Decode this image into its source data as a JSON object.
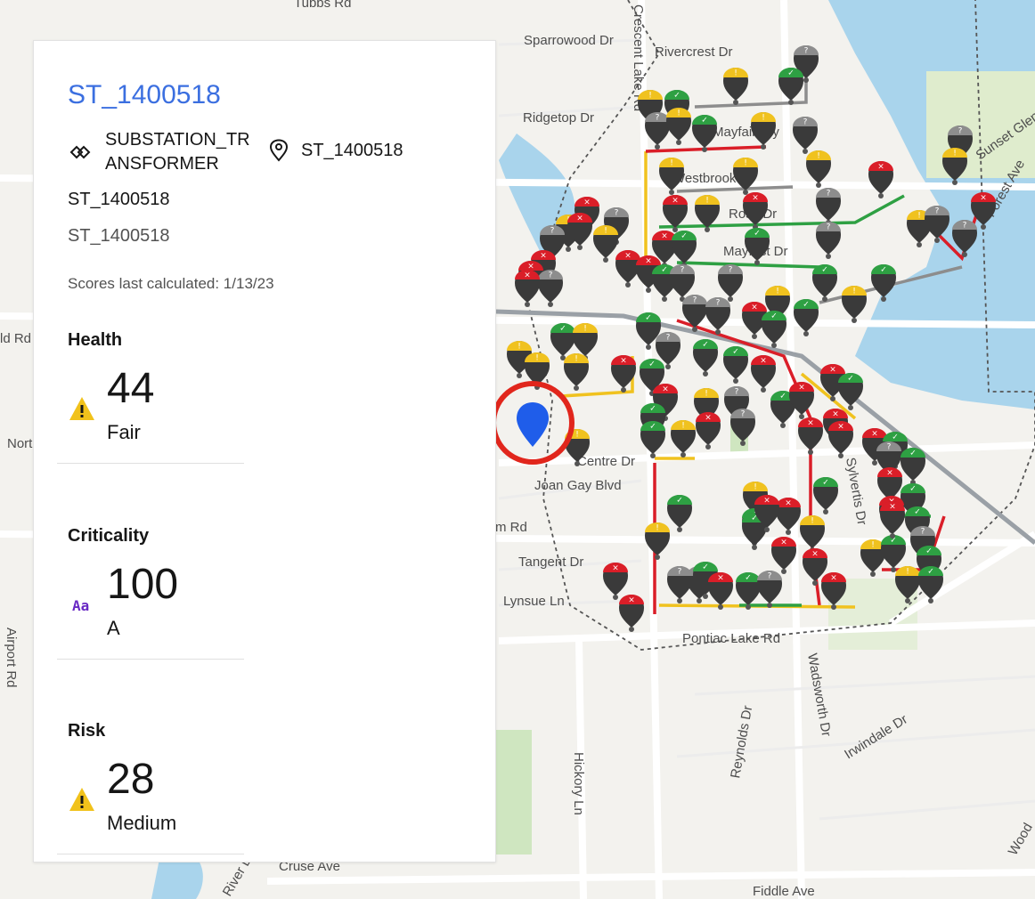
{
  "asset": {
    "title": "ST_1400518",
    "type": "SUBSTATION_TRANSFORMER",
    "location": "ST_1400518",
    "line1": "ST_1400518",
    "line2": "ST_1400518",
    "scores_calculated": "Scores last calculated: 1/13/23"
  },
  "scores": [
    {
      "label": "Health",
      "value": "44",
      "rating": "Fair",
      "icon": "warning-icon",
      "icon_color": "#f1c21b"
    },
    {
      "label": "Criticality",
      "value": "100",
      "rating": "A",
      "icon": "grade-icon",
      "icon_text": "Aa",
      "icon_color": "#6929c4"
    },
    {
      "label": "Risk",
      "value": "28",
      "rating": "Medium",
      "icon": "warning-icon",
      "icon_color": "#f1c21b"
    }
  ],
  "map": {
    "streets": [
      "Tubbs Rd",
      "Sparrowood Dr",
      "Rivercrest Dr",
      "Ridgetop Dr",
      "Crescent Lake Rd",
      "Mayfair Wy",
      "Westbrook Dr",
      "Ross Dr",
      "Mayfest Dr",
      "Centre Dr",
      "Joan Gay Blvd",
      "Tangent Dr",
      "Lynsue Ln",
      "Pontiac Lake Rd",
      "Wadsworth Dr",
      "Irwindale Dr",
      "Hickory Ln",
      "Reynolds Dr",
      "Cruse Ave",
      "Fiddle Ave",
      "Airport Rd",
      "Sylvertis Dr",
      "Sunset Glen St",
      "Forest Ave",
      "River Dr",
      "Wood",
      "Nort",
      "ld Rd",
      "m Rd"
    ],
    "marker_colors": {
      "good": "#2ea043",
      "warning": "#f0c21f",
      "critical": "#da1e28",
      "unknown": "#8d8d8d",
      "selected": "#0f62fe",
      "highlight": "#da1e28"
    }
  }
}
